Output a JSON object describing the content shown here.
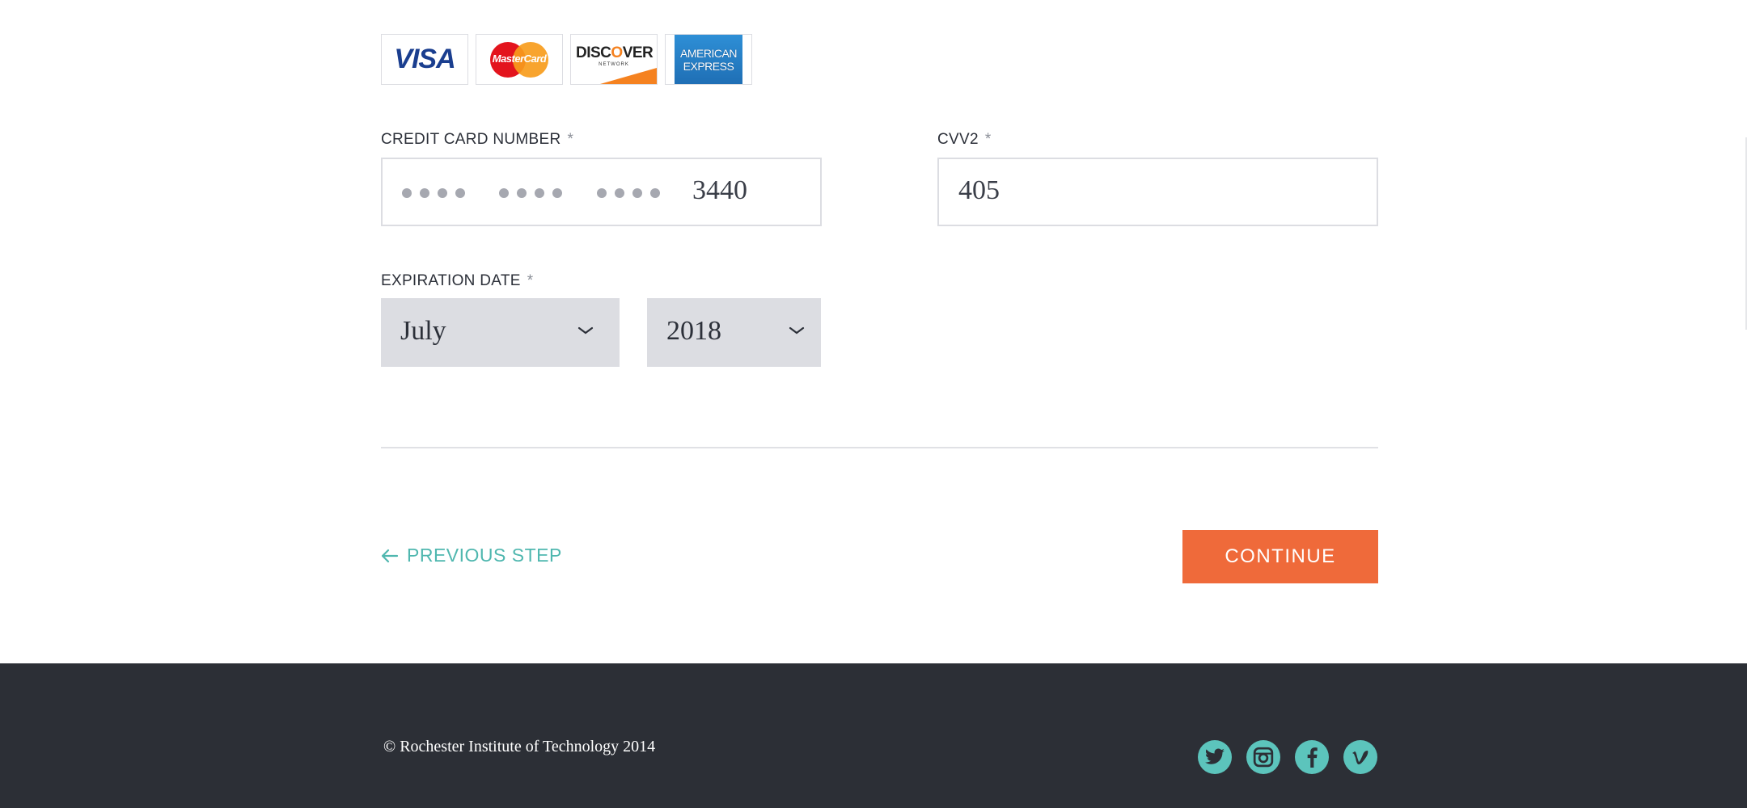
{
  "payment": {
    "card_logos": [
      {
        "name": "Visa",
        "text": "VISA"
      },
      {
        "name": "MasterCard",
        "text": "MasterCard"
      },
      {
        "name": "Discover",
        "text": "DISCOVER",
        "subtext": "NETWORK"
      },
      {
        "name": "American Express",
        "line1": "AMERICAN",
        "line2": "EXPRESS"
      }
    ],
    "card_number": {
      "label": "CREDIT CARD NUMBER",
      "required_mark": "*",
      "last_four": "3440"
    },
    "cvv": {
      "label": "CVV2",
      "required_mark": "*",
      "value": "405"
    },
    "expiration": {
      "label": "EXPIRATION DATE",
      "required_mark": "*",
      "month": "July",
      "year": "2018"
    }
  },
  "nav": {
    "previous_label": "PREVIOUS STEP",
    "continue_label": "CONTINUE"
  },
  "footer": {
    "copyright": "© Rochester Institute of Technology 2014",
    "social_icons": [
      "twitter-icon",
      "instagram-icon",
      "facebook-icon",
      "vimeo-icon"
    ]
  },
  "colors": {
    "accent": "#4fb7af",
    "continue_button": "#ef6a3a",
    "footer_bg": "#2c2f36",
    "select_bg": "#dcdde2"
  }
}
